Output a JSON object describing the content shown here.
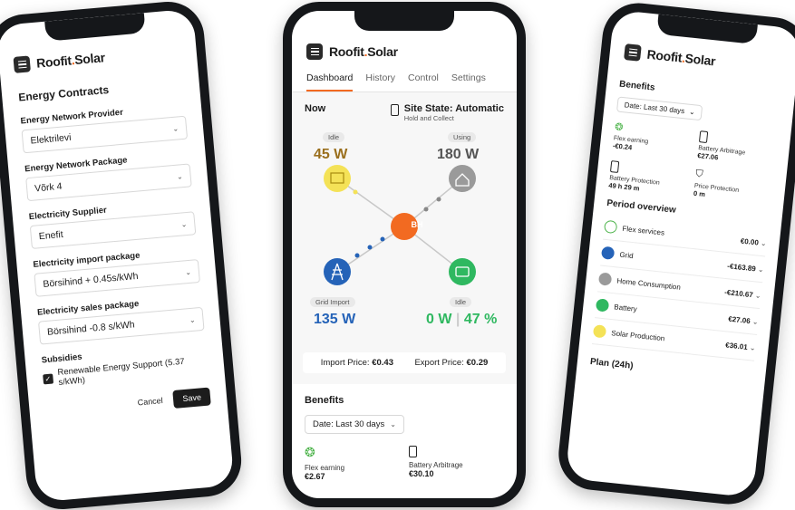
{
  "brand": {
    "name_part1": "Roofit",
    "dot": ".",
    "name_part2": "Solar"
  },
  "left": {
    "title": "Energy Contracts",
    "fields": [
      {
        "label": "Energy Network Provider",
        "value": "Elektrilevi"
      },
      {
        "label": "Energy Network Package",
        "value": "Võrk 4"
      },
      {
        "label": "Electricity Supplier",
        "value": "Enefit"
      },
      {
        "label": "Electricity import package",
        "value": "Börsihind + 0.45s/kWh"
      },
      {
        "label": "Electricity sales package",
        "value": "Börsihind -0.8 s/kWh"
      }
    ],
    "subsidies_label": "Subsidies",
    "subsidy_option": "Renewable Energy Support (5.37 s/kWh)",
    "cancel": "Cancel",
    "save": "Save"
  },
  "center": {
    "tabs": [
      "Dashboard",
      "History",
      "Control",
      "Settings"
    ],
    "now_title": "Now",
    "site_state": "Site State: Automatic",
    "site_state_sub": "Hold and Collect",
    "solar": {
      "status": "Idle",
      "value": "45 W"
    },
    "home": {
      "status": "Using",
      "value": "180 W"
    },
    "hub": "BH",
    "grid": {
      "status": "Grid Import",
      "value": "135 W"
    },
    "battery": {
      "status": "Idle",
      "value": "0 W",
      "percent": "47 %"
    },
    "import_price_label": "Import Price:",
    "import_price": "€0.43",
    "export_price_label": "Export Price:",
    "export_price": "€0.29",
    "benefits_title": "Benefits",
    "date_range": "Date: Last 30 days",
    "benefits": [
      {
        "label": "Flex earning",
        "value": "€2.67"
      },
      {
        "label": "Battery Arbitrage",
        "value": "€30.10"
      }
    ],
    "colors": {
      "solar": "#f4e257",
      "home": "#9a9a9a",
      "hub": "#f26a21",
      "grid": "#2563b8",
      "battery": "#2fb860"
    }
  },
  "right": {
    "benefits_title": "Benefits",
    "date_range": "Date: Last 30 days",
    "benefits": [
      {
        "label": "Flex earning",
        "value": "-€0.24"
      },
      {
        "label": "Battery Arbitrage",
        "value": "€27.06"
      },
      {
        "label": "Battery Protection",
        "value": "49 h 29 m"
      },
      {
        "label": "Price Protection",
        "value": "0 m"
      }
    ],
    "period_title": "Period overview",
    "period": [
      {
        "label": "Flex services",
        "amount": "€0.00",
        "color": "#ffffff"
      },
      {
        "label": "Grid",
        "amount": "-€163.89",
        "color": "#2563b8"
      },
      {
        "label": "Home Consumption",
        "amount": "-€210.67",
        "color": "#9a9a9a"
      },
      {
        "label": "Battery",
        "amount": "€27.06",
        "color": "#2fb860"
      },
      {
        "label": "Solar Production",
        "amount": "€36.01",
        "color": "#f4e257"
      }
    ],
    "plan_title": "Plan (24h)"
  }
}
